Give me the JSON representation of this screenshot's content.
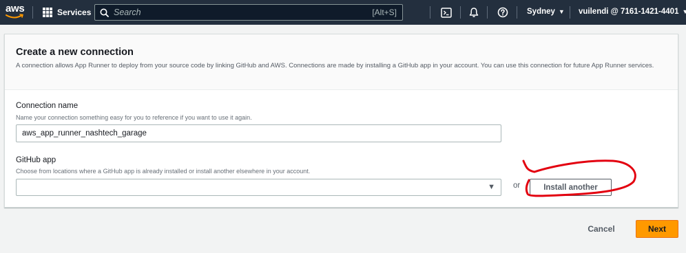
{
  "topnav": {
    "logo_text": "aws",
    "services_label": "Services",
    "search_placeholder": "Search",
    "search_shortcut": "[Alt+S]",
    "icons": [
      "cloudshell-icon",
      "bell-icon",
      "help-icon"
    ],
    "region": "Sydney",
    "account": "vuilendi @ 7161-1421-4401"
  },
  "panel": {
    "title": "Create a new connection",
    "description": "A connection allows App Runner to deploy from your source code by linking GitHub and AWS. Connections are made by installing a GitHub app in your account. You can use this connection for future App Runner services.",
    "connection_name": {
      "label": "Connection name",
      "hint": "Name your connection something easy for you to reference if you want to use it again.",
      "value": "aws_app_runner_nashtech_garage"
    },
    "github_app": {
      "label": "GitHub app",
      "hint": "Choose from locations where a GitHub app is already installed or install another elsewhere in your account.",
      "selected": "",
      "or_text": "or",
      "install_label": "Install another"
    }
  },
  "footer": {
    "cancel_label": "Cancel",
    "next_label": "Next"
  },
  "colors": {
    "nav_bg": "#232f3e",
    "primary": "#ff9900",
    "annotation": "#e3000f"
  }
}
